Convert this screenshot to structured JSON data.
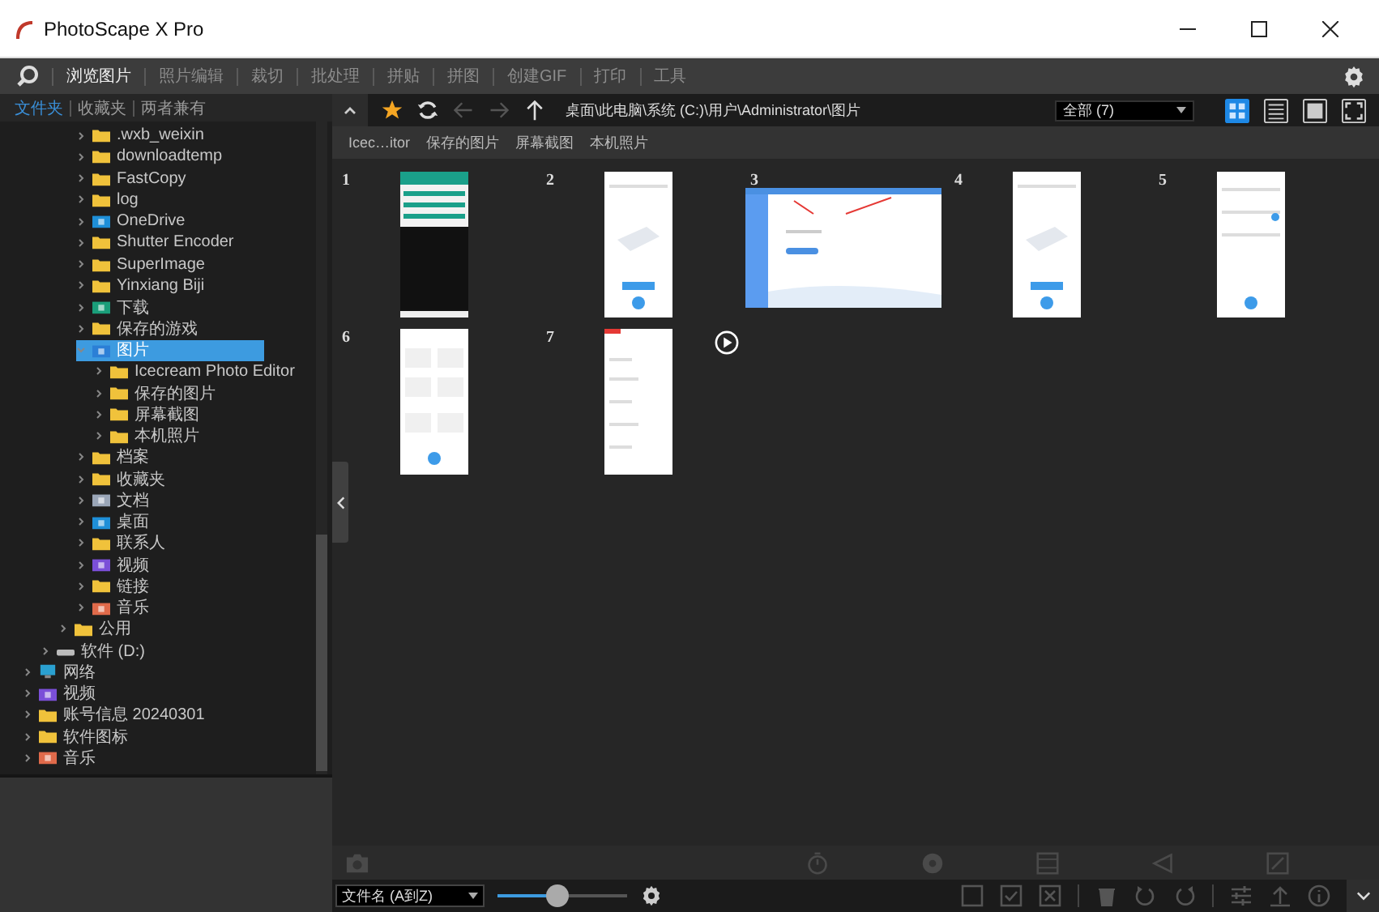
{
  "window": {
    "title": "PhotoScape X Pro"
  },
  "menu": [
    {
      "label": "浏览图片",
      "selected": true
    },
    {
      "label": "照片编辑",
      "selected": false
    },
    {
      "label": "裁切",
      "selected": false
    },
    {
      "label": "批处理",
      "selected": false
    },
    {
      "label": "拼贴",
      "selected": false
    },
    {
      "label": "拼图",
      "selected": false
    },
    {
      "label": "创建GIF",
      "selected": false
    },
    {
      "label": "打印",
      "selected": false
    },
    {
      "label": "工具",
      "selected": false
    }
  ],
  "sidebar": {
    "tabs": [
      {
        "label": "文件夹",
        "selected": true
      },
      {
        "label": "收藏夹",
        "selected": false
      },
      {
        "label": "两者兼有",
        "selected": false
      }
    ],
    "tree": [
      {
        "children": [
          {
            "children": [
              {
                "children": [
                  {
                    "label": ".wxb_weixin",
                    "kind": "folder",
                    "expanded": false,
                    "selected": false
                  },
                  {
                    "label": "downloadtemp",
                    "kind": "folder",
                    "expanded": false,
                    "selected": false
                  },
                  {
                    "label": "FastCopy",
                    "kind": "folder",
                    "expanded": false,
                    "selected": false
                  },
                  {
                    "label": "log",
                    "kind": "folder",
                    "expanded": false,
                    "selected": false
                  },
                  {
                    "label": "OneDrive",
                    "kind": "cloud",
                    "expanded": false,
                    "selected": false
                  },
                  {
                    "label": "Shutter Encoder",
                    "kind": "folder",
                    "expanded": false,
                    "selected": false
                  },
                  {
                    "label": "SuperImage",
                    "kind": "folder",
                    "expanded": false,
                    "selected": false
                  },
                  {
                    "label": "Yinxiang Biji",
                    "kind": "folder",
                    "expanded": false,
                    "selected": false
                  },
                  {
                    "label": "下载",
                    "kind": "download",
                    "expanded": false,
                    "selected": false
                  },
                  {
                    "label": "保存的游戏",
                    "kind": "folder",
                    "expanded": false,
                    "selected": false
                  },
                  {
                    "label": "图片",
                    "kind": "pictures",
                    "expanded": true,
                    "selected": true,
                    "children": [
                      {
                        "label": "Icecream Photo Editor",
                        "kind": "folder",
                        "expanded": false,
                        "selected": false
                      },
                      {
                        "label": "保存的图片",
                        "kind": "folder",
                        "expanded": false,
                        "selected": false
                      },
                      {
                        "label": "屏幕截图",
                        "kind": "folder",
                        "expanded": false,
                        "selected": false
                      },
                      {
                        "label": "本机照片",
                        "kind": "folder",
                        "expanded": false,
                        "selected": false
                      }
                    ]
                  },
                  {
                    "label": "档案",
                    "kind": "folder",
                    "expanded": false,
                    "selected": false
                  },
                  {
                    "label": "收藏夹",
                    "kind": "folder",
                    "expanded": false,
                    "selected": false
                  },
                  {
                    "label": "文档",
                    "kind": "documents",
                    "expanded": false,
                    "selected": false
                  },
                  {
                    "label": "桌面",
                    "kind": "desktop",
                    "expanded": false,
                    "selected": false
                  },
                  {
                    "label": "联系人",
                    "kind": "folder",
                    "expanded": false,
                    "selected": false
                  },
                  {
                    "label": "视频",
                    "kind": "video",
                    "expanded": false,
                    "selected": false
                  },
                  {
                    "label": "链接",
                    "kind": "folder",
                    "expanded": false,
                    "selected": false
                  },
                  {
                    "label": "音乐",
                    "kind": "music",
                    "expanded": false,
                    "selected": false
                  }
                ]
              },
              {
                "label": "公用",
                "kind": "folder",
                "expanded": false,
                "selected": false
              }
            ]
          },
          {
            "label": "软件 (D:)",
            "kind": "drive",
            "expanded": false,
            "selected": false
          }
        ]
      },
      {
        "label": "网络",
        "kind": "network",
        "expanded": false,
        "selected": false
      },
      {
        "label": "视频",
        "kind": "video",
        "expanded": false,
        "selected": false
      },
      {
        "label": "账号信息 20240301",
        "kind": "folder",
        "expanded": false,
        "selected": false
      },
      {
        "label": "软件图标",
        "kind": "folder",
        "expanded": false,
        "selected": false
      },
      {
        "label": "音乐",
        "kind": "music",
        "expanded": false,
        "selected": false
      }
    ]
  },
  "toolbar": {
    "path": "桌面\\此电脑\\系统 (C:)\\用户\\Administrator\\图片",
    "filter": "全部 (7)",
    "views": [
      {
        "kind": "grid",
        "selected": true
      },
      {
        "kind": "list",
        "selected": false
      },
      {
        "kind": "single",
        "selected": false
      },
      {
        "kind": "fullscreen",
        "selected": false
      }
    ]
  },
  "subfolders": [
    "Icec…itor",
    "保存的图片",
    "屏幕截图",
    "本机照片"
  ],
  "thumbnails": [
    {
      "number": "1",
      "kind": "dark-phone"
    },
    {
      "number": "2",
      "kind": "phone"
    },
    {
      "number": "3",
      "kind": "desktop"
    },
    {
      "number": "4",
      "kind": "phone"
    },
    {
      "number": "5",
      "kind": "settings-phone"
    },
    {
      "number": "6",
      "kind": "grid-phone"
    },
    {
      "number": "7",
      "kind": "list-phone"
    },
    {
      "kind": "video"
    }
  ],
  "bottom": {
    "sort": "文件名 (A到Z)",
    "zoom": {
      "level": 0.46
    }
  }
}
